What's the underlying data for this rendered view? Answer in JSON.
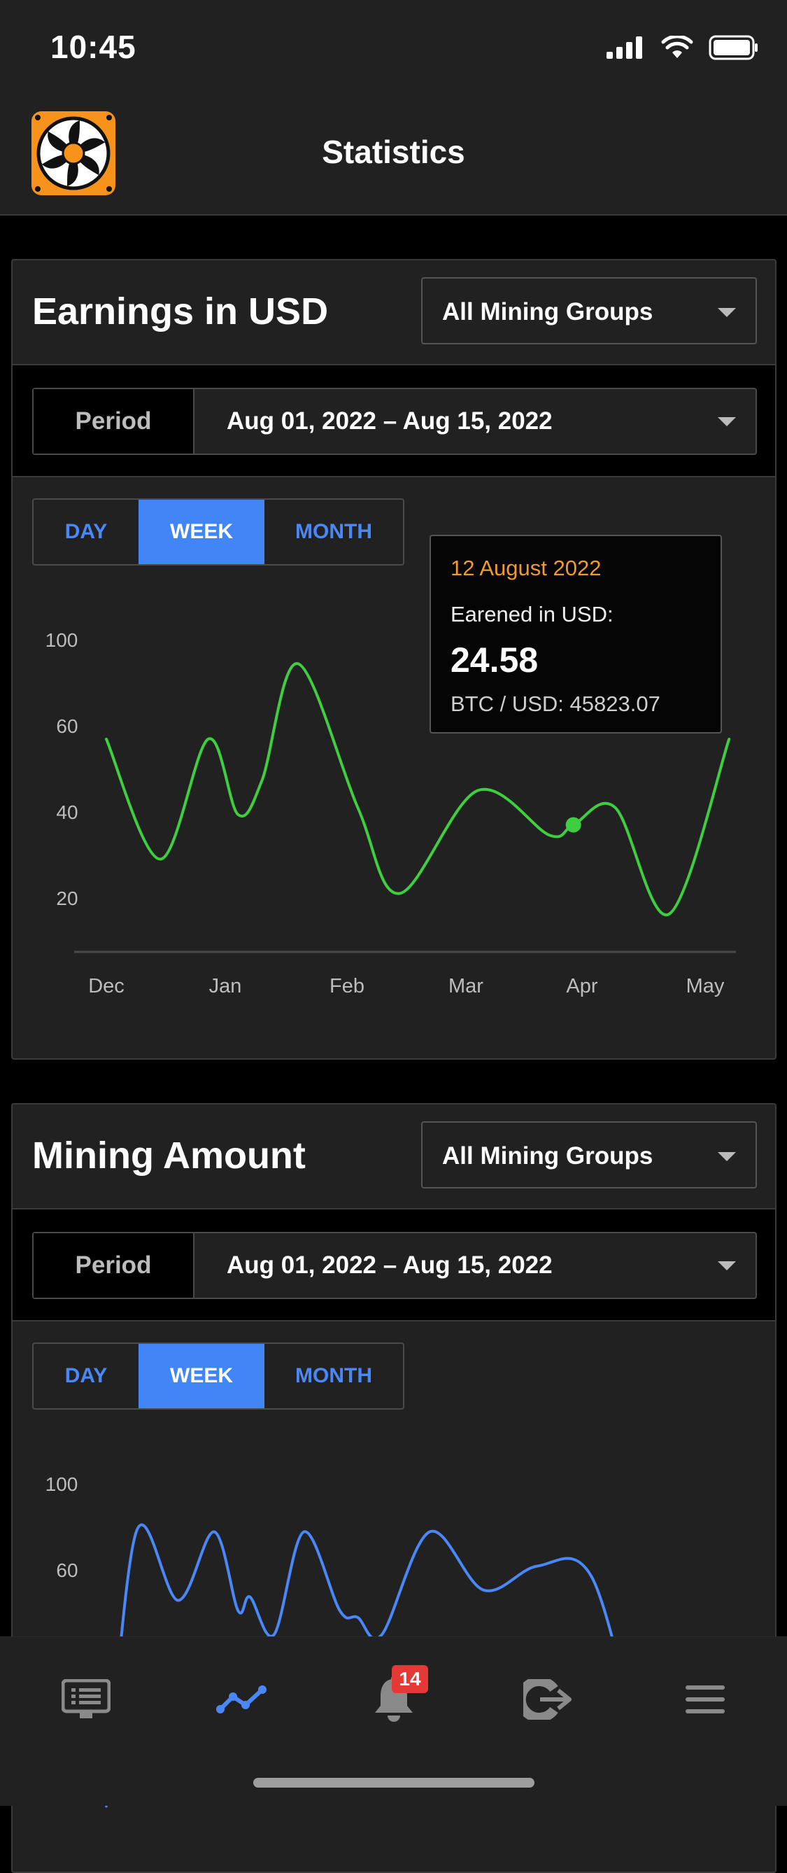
{
  "status_bar": {
    "time": "10:45"
  },
  "header": {
    "title": "Statistics"
  },
  "earnings_card": {
    "title": "Earnings in USD",
    "group_select": "All Mining Groups",
    "period_label": "Period",
    "period_value": "Aug 01, 2022 – Aug 15, 2022",
    "toggle": {
      "day": "DAY",
      "week": "WEEK",
      "month": "MONTH",
      "active": "WEEK"
    },
    "tooltip": {
      "date": "12 August 2022",
      "label": "Earened in USD:",
      "value": "24.58",
      "rate": "BTC / USD: 45823.07"
    },
    "chart_data": {
      "type": "line",
      "x_ticks": [
        "Dec",
        "Jan",
        "Feb",
        "Mar",
        "Apr",
        "May"
      ],
      "y_ticks": [
        "100",
        "60",
        "40",
        "20"
      ],
      "color": "#3fce3f",
      "points": [
        [
          0,
          70
        ],
        [
          0.45,
          35
        ],
        [
          0.85,
          70
        ],
        [
          1.1,
          48
        ],
        [
          1.3,
          58
        ],
        [
          1.6,
          92
        ],
        [
          2.1,
          50
        ],
        [
          2.45,
          25
        ],
        [
          3.1,
          55
        ],
        [
          3.7,
          42
        ],
        [
          3.9,
          45
        ],
        [
          4.25,
          50
        ],
        [
          4.7,
          19
        ],
        [
          5.2,
          70
        ]
      ],
      "highlight": [
        3.9,
        45
      ]
    }
  },
  "mining_card": {
    "title": "Mining Amount",
    "group_select": "All Mining Groups",
    "period_label": "Period",
    "period_value": "Aug 01, 2022 – Aug 15, 2022",
    "toggle": {
      "day": "DAY",
      "week": "WEEK",
      "month": "MONTH",
      "active": "WEEK"
    },
    "chart_data": {
      "type": "line",
      "y_ticks": [
        "100",
        "60"
      ],
      "color": "#4a88f7",
      "points": [
        [
          0,
          5
        ],
        [
          0.25,
          85
        ],
        [
          0.6,
          65
        ],
        [
          0.9,
          85
        ],
        [
          1.1,
          62
        ],
        [
          1.2,
          66
        ],
        [
          1.4,
          55
        ],
        [
          1.65,
          85
        ],
        [
          1.95,
          62
        ],
        [
          2.1,
          60
        ],
        [
          2.3,
          55
        ],
        [
          2.7,
          85
        ],
        [
          3.15,
          68
        ],
        [
          3.6,
          75
        ],
        [
          4.05,
          72
        ],
        [
          4.5,
          20
        ],
        [
          4.75,
          22
        ],
        [
          4.95,
          15
        ],
        [
          5.2,
          50
        ]
      ]
    }
  },
  "bottom_nav": {
    "notifications_badge": "14",
    "active": "statistics"
  }
}
